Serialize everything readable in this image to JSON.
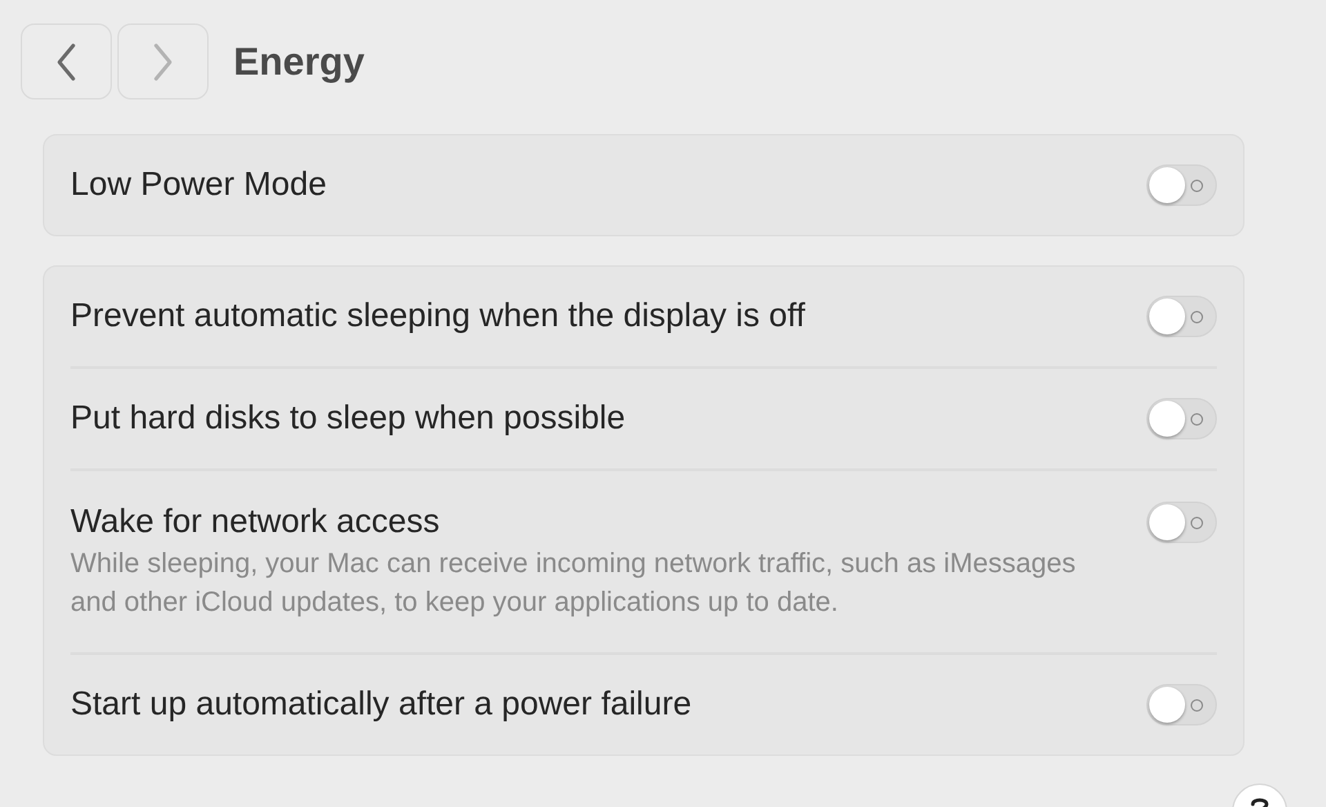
{
  "toolbar": {
    "back": {
      "disabled": false
    },
    "forward": {
      "disabled": true
    },
    "title": "Energy"
  },
  "groups": [
    {
      "rows": [
        {
          "label": "Low Power Mode",
          "on": false
        }
      ]
    },
    {
      "rows": [
        {
          "label": "Prevent automatic sleeping when the display is off",
          "on": false
        },
        {
          "label": "Put hard disks to sleep when possible",
          "on": false
        },
        {
          "label": "Wake for network access",
          "description": "While sleeping, your Mac can receive incoming network traffic, such as iMessages and other iCloud updates, to keep your applications up to date.",
          "on": false
        },
        {
          "label": "Start up automatically after a power failure",
          "on": false
        }
      ]
    }
  ]
}
